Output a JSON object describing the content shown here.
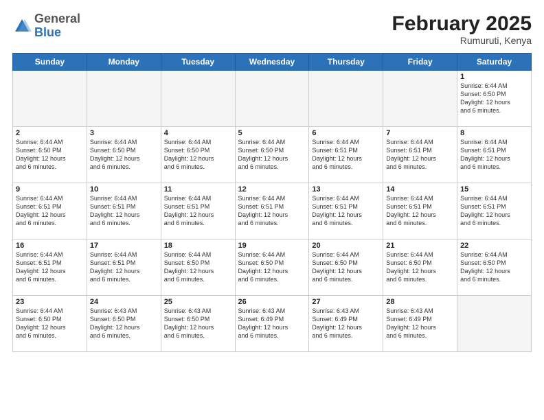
{
  "logo": {
    "general": "General",
    "blue": "Blue"
  },
  "header": {
    "month": "February 2025",
    "location": "Rumuruti, Kenya"
  },
  "weekdays": [
    "Sunday",
    "Monday",
    "Tuesday",
    "Wednesday",
    "Thursday",
    "Friday",
    "Saturday"
  ],
  "weeks": [
    [
      {
        "day": "",
        "info": ""
      },
      {
        "day": "",
        "info": ""
      },
      {
        "day": "",
        "info": ""
      },
      {
        "day": "",
        "info": ""
      },
      {
        "day": "",
        "info": ""
      },
      {
        "day": "",
        "info": ""
      },
      {
        "day": "1",
        "info": "Sunrise: 6:44 AM\nSunset: 6:50 PM\nDaylight: 12 hours\nand 6 minutes."
      }
    ],
    [
      {
        "day": "2",
        "info": "Sunrise: 6:44 AM\nSunset: 6:50 PM\nDaylight: 12 hours\nand 6 minutes."
      },
      {
        "day": "3",
        "info": "Sunrise: 6:44 AM\nSunset: 6:50 PM\nDaylight: 12 hours\nand 6 minutes."
      },
      {
        "day": "4",
        "info": "Sunrise: 6:44 AM\nSunset: 6:50 PM\nDaylight: 12 hours\nand 6 minutes."
      },
      {
        "day": "5",
        "info": "Sunrise: 6:44 AM\nSunset: 6:50 PM\nDaylight: 12 hours\nand 6 minutes."
      },
      {
        "day": "6",
        "info": "Sunrise: 6:44 AM\nSunset: 6:51 PM\nDaylight: 12 hours\nand 6 minutes."
      },
      {
        "day": "7",
        "info": "Sunrise: 6:44 AM\nSunset: 6:51 PM\nDaylight: 12 hours\nand 6 minutes."
      },
      {
        "day": "8",
        "info": "Sunrise: 6:44 AM\nSunset: 6:51 PM\nDaylight: 12 hours\nand 6 minutes."
      }
    ],
    [
      {
        "day": "9",
        "info": "Sunrise: 6:44 AM\nSunset: 6:51 PM\nDaylight: 12 hours\nand 6 minutes."
      },
      {
        "day": "10",
        "info": "Sunrise: 6:44 AM\nSunset: 6:51 PM\nDaylight: 12 hours\nand 6 minutes."
      },
      {
        "day": "11",
        "info": "Sunrise: 6:44 AM\nSunset: 6:51 PM\nDaylight: 12 hours\nand 6 minutes."
      },
      {
        "day": "12",
        "info": "Sunrise: 6:44 AM\nSunset: 6:51 PM\nDaylight: 12 hours\nand 6 minutes."
      },
      {
        "day": "13",
        "info": "Sunrise: 6:44 AM\nSunset: 6:51 PM\nDaylight: 12 hours\nand 6 minutes."
      },
      {
        "day": "14",
        "info": "Sunrise: 6:44 AM\nSunset: 6:51 PM\nDaylight: 12 hours\nand 6 minutes."
      },
      {
        "day": "15",
        "info": "Sunrise: 6:44 AM\nSunset: 6:51 PM\nDaylight: 12 hours\nand 6 minutes."
      }
    ],
    [
      {
        "day": "16",
        "info": "Sunrise: 6:44 AM\nSunset: 6:51 PM\nDaylight: 12 hours\nand 6 minutes."
      },
      {
        "day": "17",
        "info": "Sunrise: 6:44 AM\nSunset: 6:51 PM\nDaylight: 12 hours\nand 6 minutes."
      },
      {
        "day": "18",
        "info": "Sunrise: 6:44 AM\nSunset: 6:50 PM\nDaylight: 12 hours\nand 6 minutes."
      },
      {
        "day": "19",
        "info": "Sunrise: 6:44 AM\nSunset: 6:50 PM\nDaylight: 12 hours\nand 6 minutes."
      },
      {
        "day": "20",
        "info": "Sunrise: 6:44 AM\nSunset: 6:50 PM\nDaylight: 12 hours\nand 6 minutes."
      },
      {
        "day": "21",
        "info": "Sunrise: 6:44 AM\nSunset: 6:50 PM\nDaylight: 12 hours\nand 6 minutes."
      },
      {
        "day": "22",
        "info": "Sunrise: 6:44 AM\nSunset: 6:50 PM\nDaylight: 12 hours\nand 6 minutes."
      }
    ],
    [
      {
        "day": "23",
        "info": "Sunrise: 6:44 AM\nSunset: 6:50 PM\nDaylight: 12 hours\nand 6 minutes."
      },
      {
        "day": "24",
        "info": "Sunrise: 6:43 AM\nSunset: 6:50 PM\nDaylight: 12 hours\nand 6 minutes."
      },
      {
        "day": "25",
        "info": "Sunrise: 6:43 AM\nSunset: 6:50 PM\nDaylight: 12 hours\nand 6 minutes."
      },
      {
        "day": "26",
        "info": "Sunrise: 6:43 AM\nSunset: 6:49 PM\nDaylight: 12 hours\nand 6 minutes."
      },
      {
        "day": "27",
        "info": "Sunrise: 6:43 AM\nSunset: 6:49 PM\nDaylight: 12 hours\nand 6 minutes."
      },
      {
        "day": "28",
        "info": "Sunrise: 6:43 AM\nSunset: 6:49 PM\nDaylight: 12 hours\nand 6 minutes."
      },
      {
        "day": "",
        "info": ""
      }
    ]
  ]
}
